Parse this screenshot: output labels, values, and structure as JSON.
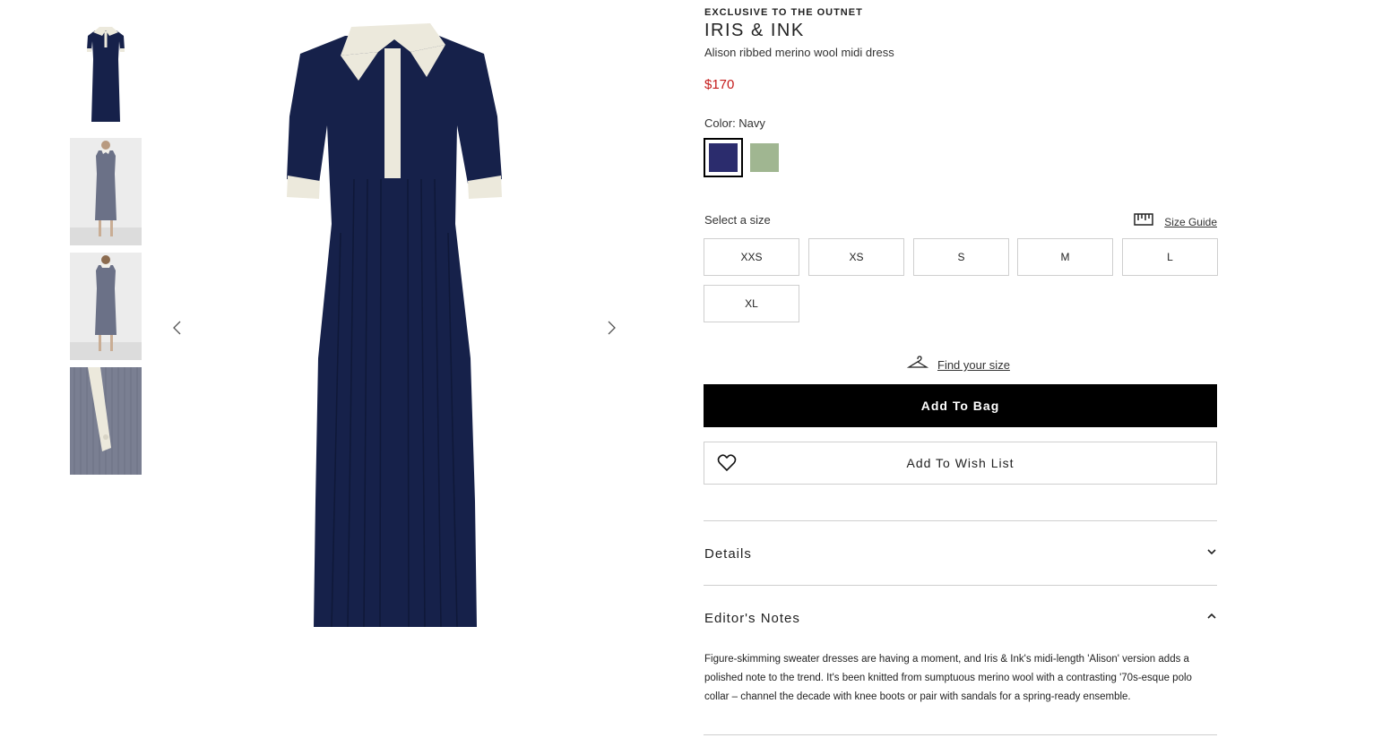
{
  "gallery": {
    "thumbnails": [
      {
        "name": "thumb-front"
      },
      {
        "name": "thumb-model-front"
      },
      {
        "name": "thumb-model-back"
      },
      {
        "name": "thumb-detail"
      }
    ],
    "dress_color": "#16214a",
    "collar_color": "#ece9dc"
  },
  "product": {
    "exclusive": "EXCLUSIVE TO THE OUTNET",
    "brand": "IRIS & INK",
    "name": "Alison ribbed merino wool midi dress",
    "price": "$170",
    "price_color": "#c41a1a"
  },
  "color": {
    "label": "Color: Navy",
    "swatches": [
      {
        "name": "Navy",
        "hex": "#2b2c6d",
        "selected": true
      },
      {
        "name": "Sage",
        "hex": "#a0b691",
        "selected": false
      }
    ]
  },
  "size": {
    "label": "Select a size",
    "guide_label": "Size Guide",
    "options": [
      "XXS",
      "XS",
      "S",
      "M",
      "L",
      "XL"
    ],
    "find_size_label": "Find your size"
  },
  "actions": {
    "add_to_bag": "Add To Bag",
    "add_to_wishlist": "Add To Wish List"
  },
  "accordion": {
    "details_title": "Details",
    "editors_notes_title": "Editor's Notes",
    "editors_notes_text": "Figure-skimming sweater dresses are having a moment, and Iris & Ink's midi-length 'Alison' version adds a polished note to the trend. It's been knitted from sumptuous merino wool with a contrasting '70s-esque polo collar – channel the decade with knee boots or pair with sandals for a spring-ready ensemble."
  }
}
